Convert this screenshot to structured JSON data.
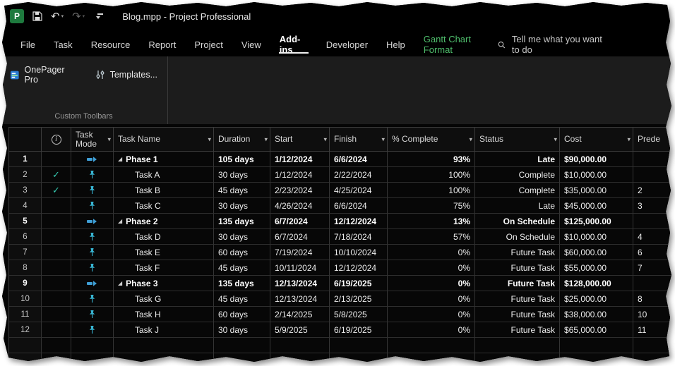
{
  "window": {
    "title": "Blog.mpp  -  Project Professional"
  },
  "qat": {
    "icons": [
      "project-app-icon",
      "save-icon",
      "undo-icon",
      "redo-icon",
      "customize-quick-access-icon"
    ],
    "app_letter": "P"
  },
  "tabs": {
    "items": [
      {
        "label": "File"
      },
      {
        "label": "Task"
      },
      {
        "label": "Resource"
      },
      {
        "label": "Report"
      },
      {
        "label": "Project"
      },
      {
        "label": "View"
      },
      {
        "label": "Add-ins"
      },
      {
        "label": "Developer"
      },
      {
        "label": "Help"
      }
    ],
    "active_label": "Add-ins",
    "contextual": "Gantt Chart Format"
  },
  "search": {
    "placeholder": "Tell me what you want to do",
    "icon": "search-icon"
  },
  "ribbon": {
    "buttons": [
      {
        "label": "OnePager Pro",
        "icon": "onepager-pro-icon"
      },
      {
        "label": "Templates...",
        "icon": "templates-sliders-icon"
      }
    ],
    "group_label": "Custom Toolbars"
  },
  "grid": {
    "columns": [
      {
        "key": "num",
        "label": "",
        "filter": false
      },
      {
        "key": "info",
        "label": "i",
        "filter": false
      },
      {
        "key": "mode",
        "label": "Task Mode",
        "filter": true
      },
      {
        "key": "name",
        "label": "Task Name",
        "filter": true
      },
      {
        "key": "duration",
        "label": "Duration",
        "filter": true
      },
      {
        "key": "start",
        "label": "Start",
        "filter": true
      },
      {
        "key": "finish",
        "label": "Finish",
        "filter": true
      },
      {
        "key": "pct",
        "label": "% Complete",
        "filter": true
      },
      {
        "key": "status",
        "label": "Status",
        "filter": true
      },
      {
        "key": "cost",
        "label": "Cost",
        "filter": true
      },
      {
        "key": "pred",
        "label": "Prede",
        "filter": false
      }
    ],
    "rows": [
      {
        "num": 1,
        "info": "",
        "mode": "auto",
        "summary": true,
        "name": "Phase 1",
        "duration": "105 days",
        "start": "1/12/2024",
        "finish": "6/6/2024",
        "pct": "93%",
        "status": "Late",
        "cost": "$90,000.00",
        "pred": ""
      },
      {
        "num": 2,
        "info": "check",
        "mode": "manual",
        "summary": false,
        "name": "Task A",
        "duration": "30 days",
        "start": "1/12/2024",
        "finish": "2/22/2024",
        "pct": "100%",
        "status": "Complete",
        "cost": "$10,000.00",
        "pred": ""
      },
      {
        "num": 3,
        "info": "check",
        "mode": "manual",
        "summary": false,
        "name": "Task B",
        "duration": "45 days",
        "start": "2/23/2024",
        "finish": "4/25/2024",
        "pct": "100%",
        "status": "Complete",
        "cost": "$35,000.00",
        "pred": "2"
      },
      {
        "num": 4,
        "info": "",
        "mode": "manual",
        "summary": false,
        "name": "Task C",
        "duration": "30 days",
        "start": "4/26/2024",
        "finish": "6/6/2024",
        "pct": "75%",
        "status": "Late",
        "cost": "$45,000.00",
        "pred": "3"
      },
      {
        "num": 5,
        "info": "",
        "mode": "auto",
        "summary": true,
        "name": "Phase 2",
        "duration": "135 days",
        "start": "6/7/2024",
        "finish": "12/12/2024",
        "pct": "13%",
        "status": "On Schedule",
        "cost": "$125,000.00",
        "pred": ""
      },
      {
        "num": 6,
        "info": "",
        "mode": "manual",
        "summary": false,
        "name": "Task D",
        "duration": "30 days",
        "start": "6/7/2024",
        "finish": "7/18/2024",
        "pct": "57%",
        "status": "On Schedule",
        "cost": "$10,000.00",
        "pred": "4"
      },
      {
        "num": 7,
        "info": "",
        "mode": "manual",
        "summary": false,
        "name": "Task E",
        "duration": "60 days",
        "start": "7/19/2024",
        "finish": "10/10/2024",
        "pct": "0%",
        "status": "Future Task",
        "cost": "$60,000.00",
        "pred": "6"
      },
      {
        "num": 8,
        "info": "",
        "mode": "manual",
        "summary": false,
        "name": "Task F",
        "duration": "45 days",
        "start": "10/11/2024",
        "finish": "12/12/2024",
        "pct": "0%",
        "status": "Future Task",
        "cost": "$55,000.00",
        "pred": "7"
      },
      {
        "num": 9,
        "info": "",
        "mode": "auto",
        "summary": true,
        "name": "Phase 3",
        "duration": "135 days",
        "start": "12/13/2024",
        "finish": "6/19/2025",
        "pct": "0%",
        "status": "Future Task",
        "cost": "$128,000.00",
        "pred": ""
      },
      {
        "num": 10,
        "info": "",
        "mode": "manual",
        "summary": false,
        "name": "Task G",
        "duration": "45 days",
        "start": "12/13/2024",
        "finish": "2/13/2025",
        "pct": "0%",
        "status": "Future Task",
        "cost": "$25,000.00",
        "pred": "8"
      },
      {
        "num": 11,
        "info": "",
        "mode": "manual",
        "summary": false,
        "name": "Task H",
        "duration": "60 days",
        "start": "2/14/2025",
        "finish": "5/8/2025",
        "pct": "0%",
        "status": "Future Task",
        "cost": "$38,000.00",
        "pred": "10"
      },
      {
        "num": 12,
        "info": "",
        "mode": "manual",
        "summary": false,
        "name": "Task J",
        "duration": "30 days",
        "start": "5/9/2025",
        "finish": "6/19/2025",
        "pct": "0%",
        "status": "Future Task",
        "cost": "$65,000.00",
        "pred": "11"
      }
    ],
    "trailing_empty_rows": 2
  },
  "colors": {
    "app_green": "#1e7a3e",
    "contextual_tab": "#4fbe6c",
    "check": "#35c9b0",
    "pin_teal": "#38b6d4",
    "auto_blue": "#3f9fd6"
  }
}
